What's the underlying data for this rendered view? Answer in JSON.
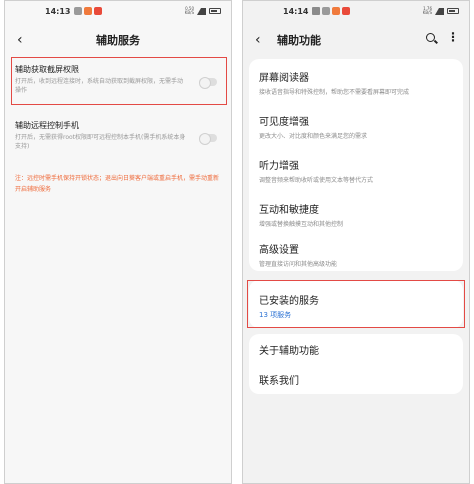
{
  "left": {
    "status": {
      "time": "14:13",
      "speed_top": "0.50",
      "speed_bottom": "KB/S"
    },
    "header": {
      "title": "辅助服务"
    },
    "settings": [
      {
        "title": "辅助获取截屏权限",
        "desc": "打开后，收到远程连接时，系统自动获取到截屏权限，无需手动操作",
        "toggle": "off"
      },
      {
        "title": "辅助远程控制手机",
        "desc": "打开后，无需获得root权限即可远程控制本手机(需手机系统本身支持)",
        "toggle": "off"
      }
    ],
    "note": "注：远控时需手机保持开锁状态；退出向日葵客户端或重启手机，需手动重新开启辅助服务",
    "colors": {
      "highlight": "#e34a45",
      "note": "#ef6a3a"
    }
  },
  "right": {
    "status": {
      "time": "14:14",
      "speed_top": "1.76",
      "speed_bottom": "KB/S"
    },
    "header": {
      "title": "辅助功能"
    },
    "groups": [
      [
        {
          "title": "屏幕阅读器",
          "desc": "接收语音指导和特殊控制，帮助您不需要看屏幕即可完成"
        },
        {
          "title": "可见度增强",
          "desc": "更改大小、对比度和颜色来满足您的需求"
        },
        {
          "title": "听力增强",
          "desc": "调整音频来帮助收听或使用文本等替代方式"
        },
        {
          "title": "互动和敏捷度",
          "desc": "增强或替换触摸互动和其他控制"
        },
        {
          "title": "高级设置",
          "desc": "管理直接访问和其他高级功能"
        }
      ],
      [
        {
          "title": "已安装的服务",
          "sub": "13 项服务"
        }
      ],
      [
        {
          "title": "关于辅助功能"
        },
        {
          "title": "联系我们"
        }
      ]
    ],
    "colors": {
      "accent": "#2f74d4",
      "highlight": "#e34a45"
    }
  }
}
